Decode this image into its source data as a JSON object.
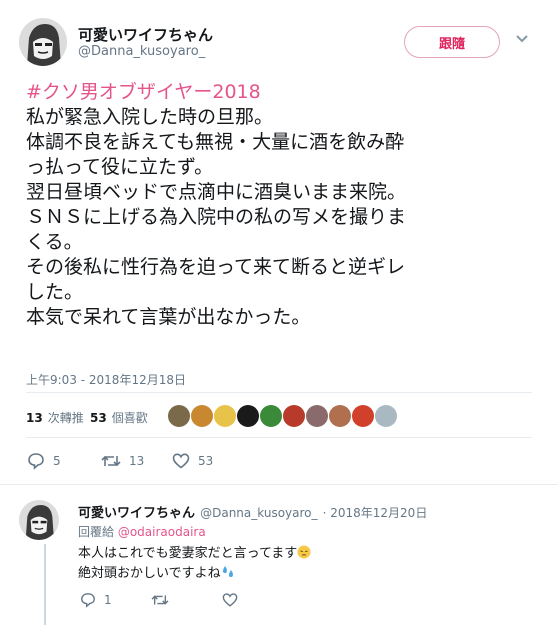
{
  "tweet": {
    "display_name": "可愛いワイフちゃん",
    "handle": "@Danna_kusoyaro_",
    "follow_label": "跟隨",
    "hashtag": "#クソ男オブザイヤー2018",
    "lines": [
      "私が緊急入院した時の旦那。",
      "体調不良を訴えても無視・大量に酒を飲み酔",
      "っ払って役に立たず。",
      "翌日昼頃ベッドで点滴中に酒臭いまま来院。",
      "ＳＮＳに上げる為入院中の私の写メを撮りま",
      "くる。",
      "その後私に性行為を迫って来て断ると逆ギレ",
      "した。",
      "本気で呆れて言葉が出なかった。"
    ],
    "timestamp": "上午9:03 - 2018年12月18日",
    "retweet_count": "13",
    "retweet_label": "次轉推",
    "like_count": "53",
    "like_label": "個喜歡",
    "likers": [
      "#7a6a4a",
      "#c9872f",
      "#e7c34a",
      "#1a1a1a",
      "#3a8a3a",
      "#b83a2a",
      "#8a6a6a",
      "#b07050",
      "#d0402a",
      "#aab8c2"
    ],
    "actions": {
      "reply": "5",
      "retweet": "13",
      "like": "53"
    }
  },
  "reply": {
    "display_name": "可愛いワイフちゃん",
    "handle": "@Danna_kusoyaro_",
    "date": "· 2018年12月20日",
    "replying_label": "回覆給",
    "replying_to": "@odairaodaira",
    "line1": "本人はこれでも愛妻家だと言ってます",
    "line2": "絶対頭おかしいですよね",
    "actions": {
      "reply": "1",
      "retweet": "",
      "like": ""
    }
  },
  "colors": {
    "accent": "#e5548b",
    "like": "#e0245e",
    "muted": "#657786"
  }
}
